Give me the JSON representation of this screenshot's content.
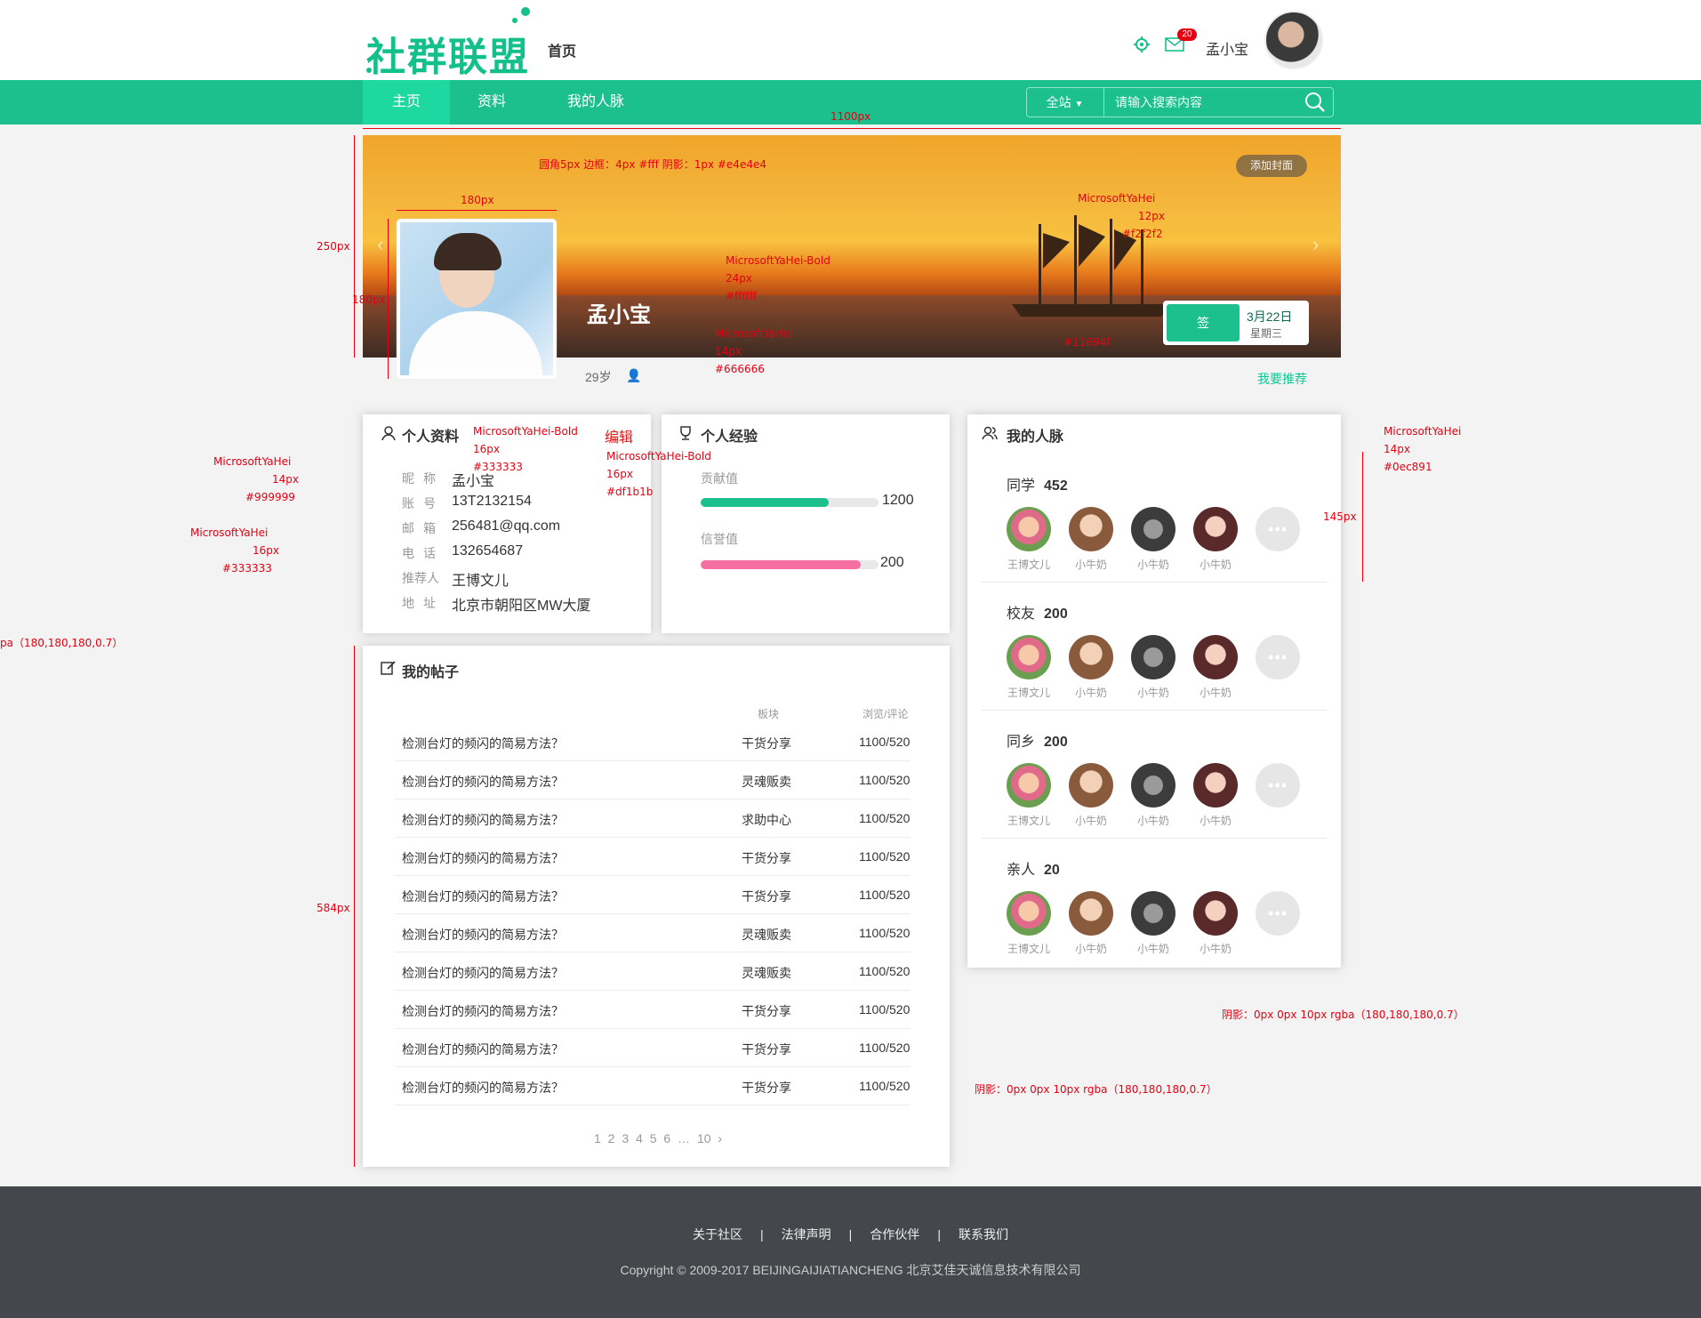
{
  "header": {
    "logo_text": "社群联盟",
    "home_link": "首页",
    "mail_count": "20",
    "user_name": "孟小宝"
  },
  "nav": {
    "items": [
      "主页",
      "资料",
      "我的人脉"
    ],
    "search_scope": "全站",
    "search_placeholder": "请输入搜索内容"
  },
  "banner": {
    "add_cover": "添加封面",
    "sign_button": "签",
    "date": "3月22日",
    "weekday": "星期三",
    "name": "孟小宝",
    "age": "29岁",
    "recommend": "我要推荐"
  },
  "profile": {
    "title": "个人资料",
    "edit": "编辑",
    "rows": [
      {
        "label": "昵称",
        "value": "孟小宝"
      },
      {
        "label": "账号",
        "value": "13T2132154"
      },
      {
        "label": "邮箱",
        "value": "256481@qq.com"
      },
      {
        "label": "电话",
        "value": "132654687"
      },
      {
        "label": "推荐人",
        "value": "王博文儿"
      },
      {
        "label": "地址",
        "value": "北京市朝阳区MW大厦"
      }
    ]
  },
  "experience": {
    "title": "个人经验",
    "items": [
      {
        "label": "贡献值",
        "value": "1200",
        "color": "#1bc08c",
        "fill": 0.72
      },
      {
        "label": "信誉值",
        "value": "200",
        "color": "#f56fa5",
        "fill": 0.9
      }
    ]
  },
  "network": {
    "title": "我的人脉",
    "more": "•••",
    "groups": [
      {
        "name": "同学",
        "count": "452",
        "friends": [
          "王博文儿",
          "小牛奶",
          "小牛奶",
          "小牛奶"
        ]
      },
      {
        "name": "校友",
        "count": "200",
        "friends": [
          "王博文儿",
          "小牛奶",
          "小牛奶",
          "小牛奶"
        ]
      },
      {
        "name": "同乡",
        "count": "200",
        "friends": [
          "王博文儿",
          "小牛奶",
          "小牛奶",
          "小牛奶"
        ]
      },
      {
        "name": "亲人",
        "count": "20",
        "friends": [
          "王博文儿",
          "小牛奶",
          "小牛奶",
          "小牛奶"
        ]
      }
    ]
  },
  "posts": {
    "title": "我的帖子",
    "col_cat": "板块",
    "col_stat": "浏览/评论",
    "rows": [
      {
        "title": "检测台灯的频闪的简易方法？",
        "cat": "干货分享",
        "stat": "1100/520"
      },
      {
        "title": "检测台灯的频闪的简易方法？",
        "cat": "灵魂贩卖",
        "stat": "1100/520"
      },
      {
        "title": "检测台灯的频闪的简易方法？",
        "cat": "求助中心",
        "stat": "1100/520"
      },
      {
        "title": "检测台灯的频闪的简易方法？",
        "cat": "干货分享",
        "stat": "1100/520"
      },
      {
        "title": "检测台灯的频闪的简易方法？",
        "cat": "干货分享",
        "stat": "1100/520"
      },
      {
        "title": "检测台灯的频闪的简易方法？",
        "cat": "灵魂贩卖",
        "stat": "1100/520"
      },
      {
        "title": "检测台灯的频闪的简易方法？",
        "cat": "灵魂贩卖",
        "stat": "1100/520"
      },
      {
        "title": "检测台灯的频闪的简易方法？",
        "cat": "干货分享",
        "stat": "1100/520"
      },
      {
        "title": "检测台灯的频闪的简易方法？",
        "cat": "干货分享",
        "stat": "1100/520"
      },
      {
        "title": "检测台灯的频闪的简易方法？",
        "cat": "干货分享",
        "stat": "1100/520"
      }
    ],
    "pager": "1 2 3 4 5 6 … 10 ›"
  },
  "footer": {
    "links": [
      "关于社区",
      "法律声明",
      "合作伙伴",
      "联系我们"
    ],
    "separator": "|",
    "copyright": "Copyright © 2009-2017 BEIJINGAIJIATIANCHENG 北京艾佳天诚信息技术有限公司"
  },
  "annotations": {
    "w1100": "1100px",
    "h250": "250px",
    "w180": "180px",
    "h180": "180px",
    "border_note": "圆角5px 边框：4px #fff 阴影：1px #e4e4e4",
    "name_font": "MicrosoftYaHei-Bold",
    "name_size": "24px",
    "name_color": "#ffffff",
    "age_font": "MicrosoftYaHei",
    "age_size": "14px",
    "age_color": "#666666",
    "cover_font": "MicrosoftYaHei",
    "cover_size": "12px",
    "cover_color": "#f2f2f2",
    "date_color": "#11694f",
    "rec_font": "MicrosoftYaHei",
    "rec_size": "14px",
    "rec_color": "#0ec891",
    "h584": "584px",
    "h145": "145px",
    "shadow1": "阴影：0px 0px 10px rgba（180,180,180,0.7）",
    "shadow2": "阴影：0px 0px 10px rgba（180,180,180,0.7）",
    "shadow3": "pa（180,180,180,0.7）",
    "label_font": "MicrosoftYaHei",
    "label_size": "14px",
    "label_color": "#999999",
    "value_font": "MicrosoftYaHei",
    "value_size": "16px",
    "value_color": "#333333",
    "edit_font": "MicrosoftYaHei-Bold",
    "edit_size": "16px",
    "edit_color": "#df1b1b",
    "title_font": "MicrosoftYaHei-Bold",
    "title_size": "16px",
    "title_color": "#333333"
  }
}
